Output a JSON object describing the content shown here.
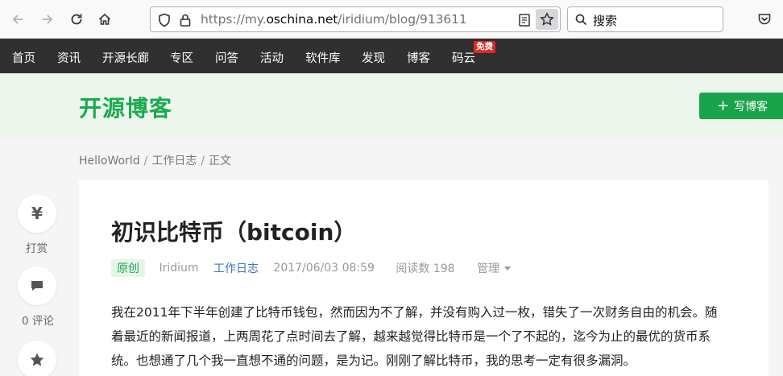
{
  "browser": {
    "url_prefix": "https://my.",
    "url_domain": "oschina.net",
    "url_path": "/iridium/blog/913611",
    "search_placeholder": "搜索"
  },
  "nav": {
    "items": [
      "首页",
      "资讯",
      "开源长廊",
      "专区",
      "问答",
      "活动",
      "软件库",
      "发现",
      "博客",
      "码云"
    ],
    "badge": "免费"
  },
  "blog": {
    "title": "开源博客",
    "write_button": "写博客"
  },
  "breadcrumb": [
    "HelloWorld",
    "工作日志",
    "正文"
  ],
  "side": {
    "reward_label": "打赏",
    "comment_label": "0 评论"
  },
  "article": {
    "title": "初识比特币（bitcoin）",
    "original_tag": "原创",
    "author": "Iridium",
    "category": "工作日志",
    "date": "2017/06/03 08:59",
    "reads": "阅读数 198",
    "manage": "管理",
    "paragraph_lines": [
      "我在2011年下半年创建了比特币钱包，然而因为不了解，并没有购入过一枚，错失了一次财务自由的机会。随",
      "着最近的新闻报道，上两周花了点时间去了解，越来越觉得比特币是一个了不起的，迄今为止的最优的货币系",
      "统。也想通了几个我一直想不通的问题，是为记。刚刚了解比特币，我的思考一定有很多漏洞。"
    ]
  },
  "colors": {
    "brand_green": "#1aaa4f",
    "nav_bg": "#303030",
    "header_bg": "#ecf6ed"
  }
}
